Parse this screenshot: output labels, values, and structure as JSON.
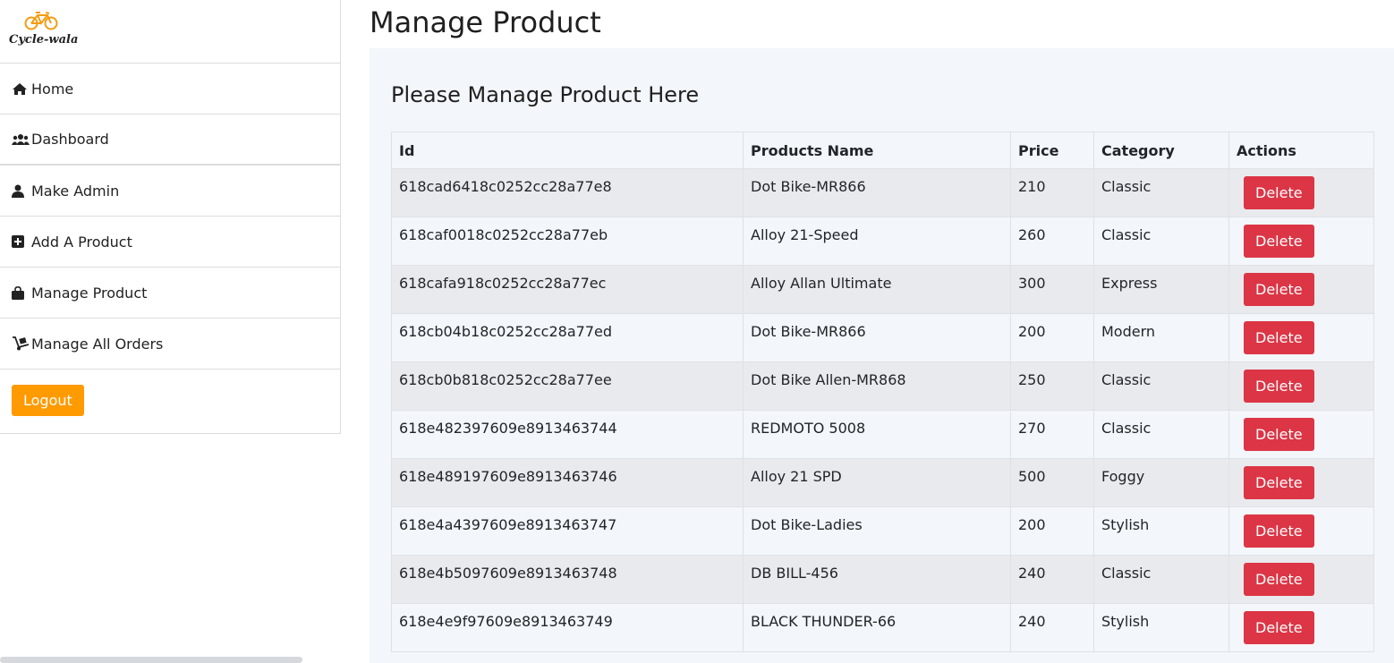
{
  "brand": {
    "logo_text": "Cycle-wala"
  },
  "sidebar": {
    "items": [
      {
        "label": "Home",
        "icon": "home-icon"
      },
      {
        "label": "Dashboard",
        "icon": "users-icon"
      },
      {
        "label": "Make Admin",
        "icon": "user-icon"
      },
      {
        "label": "Add A Product",
        "icon": "plus-square-icon"
      },
      {
        "label": "Manage Product",
        "icon": "shopping-bag-icon"
      },
      {
        "label": "Manage All Orders",
        "icon": "dolly-icon"
      }
    ],
    "logout_label": "Logout"
  },
  "page": {
    "title": "Manage Product",
    "panel_title": "Please Manage Product Here"
  },
  "table": {
    "headers": [
      "Id",
      "Products Name",
      "Price",
      "Category",
      "Actions"
    ],
    "delete_label": "Delete",
    "rows": [
      {
        "id": "618cad6418c0252cc28a77e8",
        "name": "Dot Bike-MR866",
        "price": "210",
        "category": "Classic"
      },
      {
        "id": "618caf0018c0252cc28a77eb",
        "name": "Alloy 21-Speed",
        "price": "260",
        "category": "Classic"
      },
      {
        "id": "618cafa918c0252cc28a77ec",
        "name": "Alloy Allan Ultimate",
        "price": "300",
        "category": "Express"
      },
      {
        "id": "618cb04b18c0252cc28a77ed",
        "name": "Dot Bike-MR866",
        "price": "200",
        "category": "Modern"
      },
      {
        "id": "618cb0b818c0252cc28a77ee",
        "name": "Dot Bike Allen-MR868",
        "price": "250",
        "category": "Classic"
      },
      {
        "id": "618e482397609e8913463744",
        "name": "REDMOTO 5008",
        "price": "270",
        "category": "Classic"
      },
      {
        "id": "618e489197609e8913463746",
        "name": "Alloy 21 SPD",
        "price": "500",
        "category": "Foggy"
      },
      {
        "id": "618e4a4397609e8913463747",
        "name": "Dot Bike-Ladies",
        "price": "200",
        "category": "Stylish"
      },
      {
        "id": "618e4b5097609e8913463748",
        "name": "DB BILL-456",
        "price": "240",
        "category": "Classic"
      },
      {
        "id": "618e4e9f97609e8913463749",
        "name": "BLACK THUNDER-66",
        "price": "240",
        "category": "Stylish"
      }
    ]
  },
  "colors": {
    "accent_orange": "#ff9a00",
    "danger_red": "#dc3545",
    "panel_bg": "#f3f6fa"
  }
}
